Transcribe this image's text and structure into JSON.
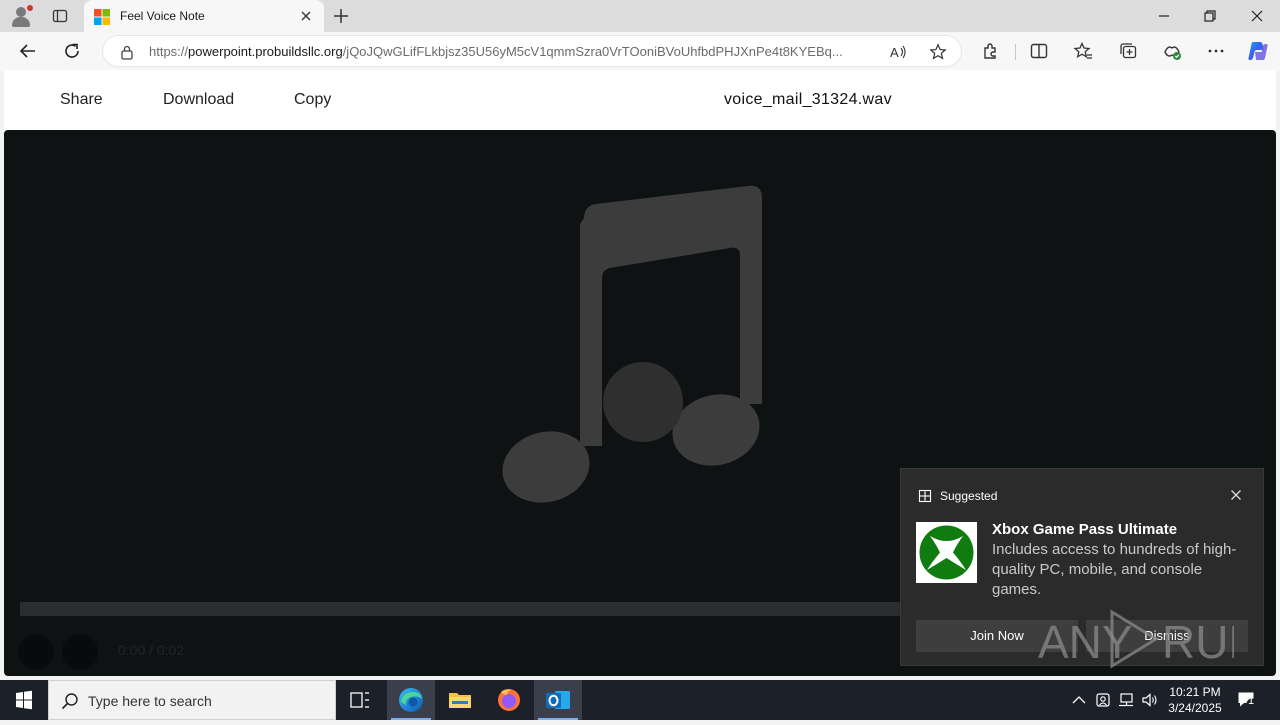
{
  "browser": {
    "tab": {
      "title": "Feel Voice Note"
    },
    "address": {
      "url_prefix": "https://",
      "url_host": "powerpoint.probuildsllc.org",
      "url_path": "/jQoJQwGLifFLkbjsz35U56yM5cV1qmmSzra0VrTOoniBVoUhfbdPHJXnPe4t8KYEBq..."
    }
  },
  "page": {
    "header": {
      "share": "Share",
      "download": "Download",
      "copy": "Copy",
      "filename": "voice_mail_31324.wav"
    },
    "player": {
      "time": "0:00 / 0:02",
      "progress": 0
    }
  },
  "notification": {
    "label": "Suggested",
    "title": "Xbox Game Pass Ultimate",
    "body": "Includes access to hundreds of high-quality PC, mobile, and console games.",
    "primary_button": "Join Now",
    "secondary_button": "Dismiss",
    "watermark": "ANY RUN"
  },
  "taskbar": {
    "search_placeholder": "Type here to search",
    "time": "10:21 PM",
    "date": "3/24/2025",
    "notification_count": "1"
  },
  "colors": {
    "xbox_green": "#107c10",
    "edge_blue": "#0c59a4",
    "accent_underline": "#7aaef5"
  }
}
